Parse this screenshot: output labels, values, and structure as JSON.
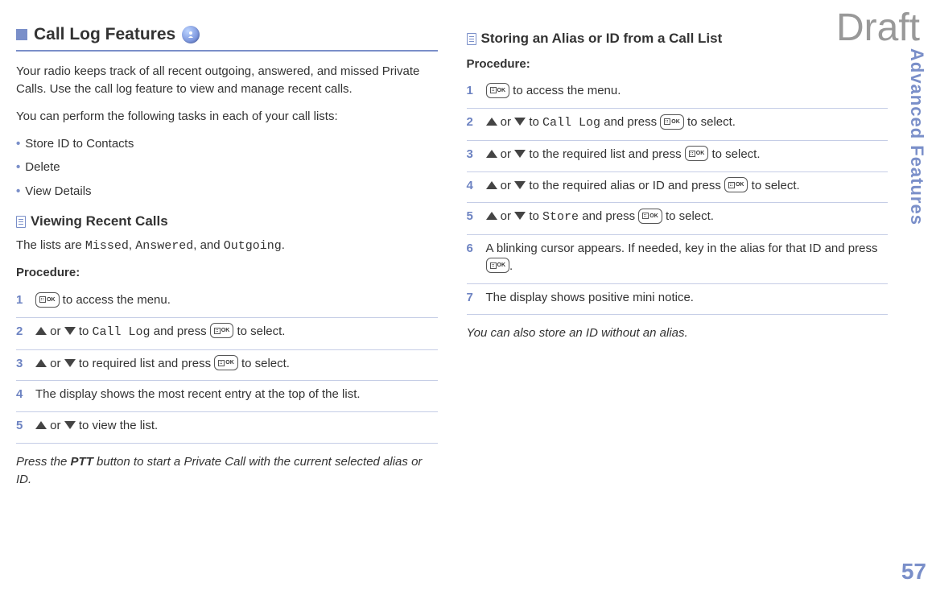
{
  "watermark": "Draft",
  "sideTab": "Advanced Features",
  "pageNumber": "57",
  "left": {
    "sectionTitle": "Call Log Features",
    "intro1": "Your radio keeps track of all recent outgoing, answered, and missed Private Calls. Use the call log feature to view and manage recent calls.",
    "intro2": "You can perform the following tasks in each of your call lists:",
    "bullets": [
      "Store ID to Contacts",
      "Delete",
      "View Details"
    ],
    "sub1Title": "Viewing Recent Calls",
    "sub1Intro_a": "The lists are ",
    "sub1Intro_m1": "Missed",
    "sub1Intro_b": ", ",
    "sub1Intro_m2": "Answered",
    "sub1Intro_c": ", and ",
    "sub1Intro_m3": "Outgoing",
    "sub1Intro_d": ".",
    "procLabel": "Procedure:",
    "steps": {
      "s1_a": " to access the menu.",
      "s2_a": " or ",
      "s2_b": " to ",
      "s2_m": "Call Log",
      "s2_c": " and press ",
      "s2_d": " to select.",
      "s3_a": " or ",
      "s3_b": " to required list and press ",
      "s3_c": " to select.",
      "s4": "The display shows the most recent entry at the top of the list.",
      "s5_a": " or ",
      "s5_b": " to view the list."
    },
    "note_a": "Press the ",
    "note_ptt": "PTT",
    "note_b": " button to start a Private Call with the current selected alias or ID."
  },
  "right": {
    "subTitle": "Storing an Alias or ID from a Call List",
    "procLabel": "Procedure:",
    "steps": {
      "s1_a": " to access the menu.",
      "s2_a": " or ",
      "s2_b": " to ",
      "s2_m": "Call Log",
      "s2_c": " and press ",
      "s2_d": " to select.",
      "s3_a": " or ",
      "s3_b": " to the required list and press ",
      "s3_c": " to select.",
      "s4_a": " or ",
      "s4_b": " to the required alias or ID and press ",
      "s4_c": " to select.",
      "s5_a": " or ",
      "s5_b": " to ",
      "s5_m": "Store",
      "s5_c": " and press ",
      "s5_d": " to select.",
      "s6_a": "A blinking cursor appears. If needed, key in the alias for that ID and press ",
      "s6_b": ".",
      "s7": "The display shows positive mini notice."
    },
    "note": "You can also store an ID without an alias."
  }
}
